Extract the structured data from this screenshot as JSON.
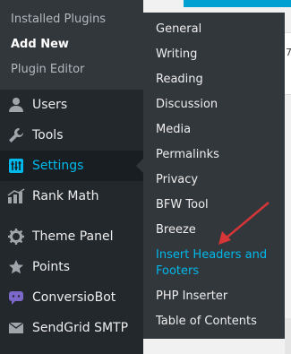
{
  "plugins_submenu": {
    "items": [
      {
        "label": "Installed Plugins"
      },
      {
        "label": "Add New"
      },
      {
        "label": "Plugin Editor"
      }
    ]
  },
  "menu": {
    "users": "Users",
    "tools": "Tools",
    "settings": "Settings",
    "rank_math": "Rank Math",
    "theme_panel": "Theme Panel",
    "points": "Points",
    "conversiobot": "ConversioBot",
    "sendgrid": "SendGrid SMTP"
  },
  "settings_flyout": {
    "items": [
      "General",
      "Writing",
      "Reading",
      "Discussion",
      "Media",
      "Permalinks",
      "Privacy",
      "BFW Tool",
      "Breeze",
      "Insert Headers and",
      "Footers",
      "PHP Inserter",
      "Table of Contents"
    ]
  },
  "content": {
    "right_char": "7"
  },
  "colors": {
    "sidebar_bg": "#23282d",
    "submenu_bg": "#32373c",
    "accent": "#00b9eb",
    "annotation_arrow": "#d63638"
  },
  "icons": {
    "users": "user-icon",
    "tools": "wrench-icon",
    "settings": "settings-sliders-icon",
    "rank_math": "chart-icon",
    "theme_panel": "gear-icon",
    "points": "star-icon",
    "conversiobot": "chat-bubble-icon",
    "sendgrid": "envelope-icon"
  }
}
